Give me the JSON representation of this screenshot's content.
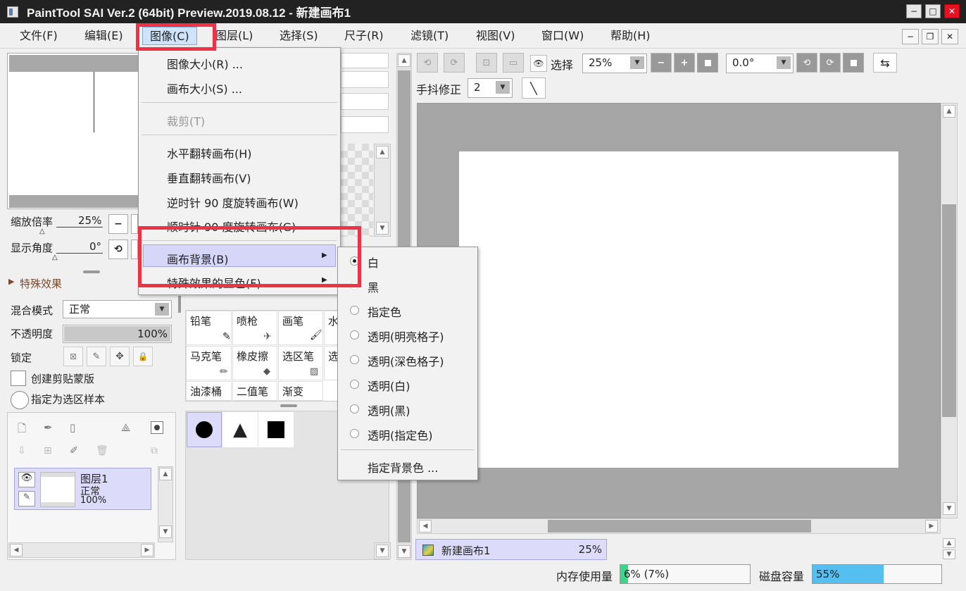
{
  "window": {
    "title": "PaintTool SAI Ver.2 (64bit) Preview.2019.08.12 - 新建画布1",
    "minimize": "−",
    "maximize": "□",
    "close": "✕"
  },
  "menubar": {
    "items": [
      "文件(F)",
      "编辑(E)",
      "图像(C)",
      "图层(L)",
      "选择(S)",
      "尺子(R)",
      "滤镜(T)",
      "视图(V)",
      "窗口(W)",
      "帮助(H)"
    ],
    "active": "图像(C)"
  },
  "navigator": {
    "zoom_label": "缩放倍率",
    "zoom_value": "25%",
    "angle_label": "显示角度",
    "angle_value": "0°"
  },
  "effects": {
    "header": "特殊效果"
  },
  "layer_props": {
    "blend_label": "混合模式",
    "blend_value": "正常",
    "opacity_label": "不透明度",
    "opacity_value": "100%",
    "opacity_fraction": 1.0,
    "lock_label": "锁定",
    "clip_label": "创建剪贴蒙版",
    "sample_label": "指定为选区样本"
  },
  "layers": {
    "items": [
      {
        "name": "图层1",
        "mode": "正常",
        "opacity": "100%"
      }
    ]
  },
  "tools": {
    "rows": [
      [
        "铅笔",
        "喷枪",
        "画笔",
        "水"
      ],
      [
        "马克笔",
        "橡皮擦",
        "选区笔",
        "选"
      ],
      [
        "油漆桶",
        "二值笔",
        "渐变",
        ""
      ]
    ]
  },
  "toolbar": {
    "select_label": "选择",
    "zoom_value": "25%",
    "angle_value": "0.0°",
    "stabilizer_label": "手抖修正",
    "stabilizer_value": "2"
  },
  "canvas_tab": {
    "name": "新建画布1",
    "zoom": "25%"
  },
  "status": {
    "memory_label": "内存使用量",
    "memory_value": "6% (7%)",
    "memory_fraction": 0.06,
    "disk_label": "磁盘容量",
    "disk_value": "55%",
    "disk_fraction": 0.55
  },
  "image_menu": {
    "items": [
      {
        "label": "图像大小(R) ...",
        "disabled": false
      },
      {
        "label": "画布大小(S) ...",
        "disabled": false
      },
      {
        "label": "裁剪(T)",
        "disabled": true
      },
      {
        "label": "水平翻转画布(H)",
        "disabled": false
      },
      {
        "label": "垂直翻转画布(V)",
        "disabled": false
      },
      {
        "label": "逆时针 90 度旋转画布(W)",
        "disabled": false
      },
      {
        "label": "顺时针 90 度旋转画布(G)",
        "disabled": false
      },
      {
        "label": "画布背景(B)",
        "disabled": false
      },
      {
        "label": "特殊效果的显色(F)",
        "disabled": false
      }
    ]
  },
  "background_submenu": {
    "items": [
      "白",
      "黑",
      "指定色",
      "透明(明亮格子)",
      "透明(深色格子)",
      "透明(白)",
      "透明(黑)",
      "透明(指定色)"
    ],
    "selected": "白",
    "footer": "指定背景色 ..."
  },
  "colors": {
    "highlight_red": "#ee3344",
    "menu_hover": "#d6d6f8",
    "disk_bar": "#55c0f0",
    "memory_bar": "#3cd68a"
  }
}
